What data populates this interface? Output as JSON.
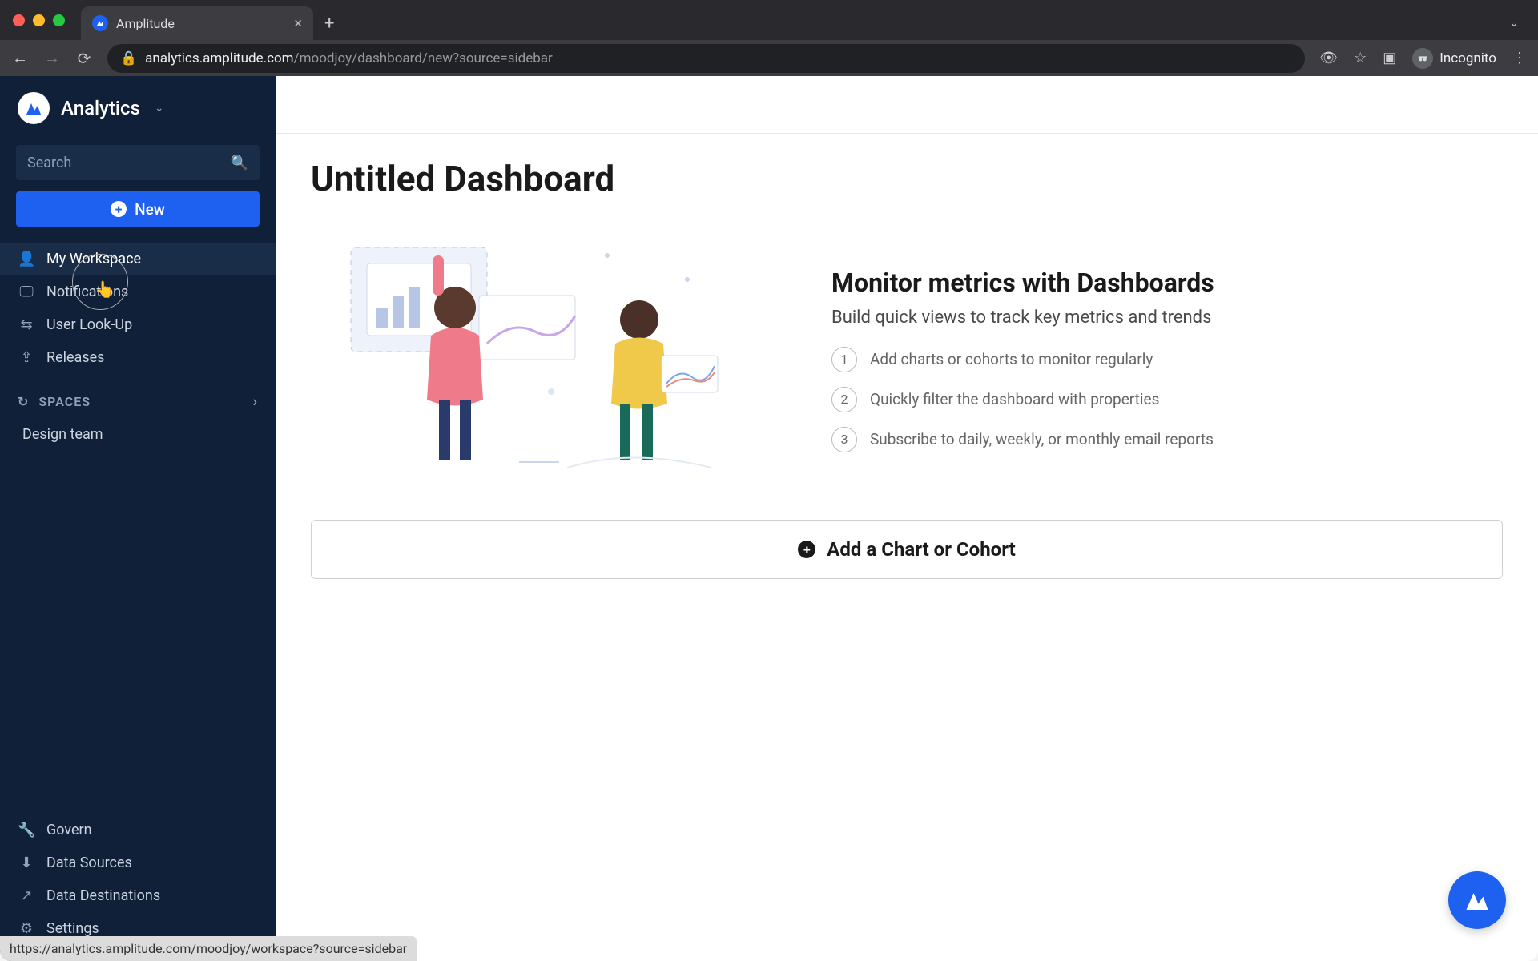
{
  "browser": {
    "tab_title": "Amplitude",
    "url_domain": "analytics.amplitude.com",
    "url_path": "/moodjoy/dashboard/new?source=sidebar",
    "incognito_label": "Incognito"
  },
  "sidebar": {
    "brand": "Analytics",
    "search_placeholder": "Search",
    "new_label": "New",
    "nav": [
      {
        "label": "My Workspace"
      },
      {
        "label": "Notifications"
      },
      {
        "label": "User Look-Up"
      },
      {
        "label": "Releases"
      }
    ],
    "spaces_header": "SPACES",
    "spaces": [
      {
        "label": "Design team"
      }
    ],
    "bottom": [
      {
        "label": "Govern"
      },
      {
        "label": "Data Sources"
      },
      {
        "label": "Data Destinations"
      },
      {
        "label": "Settings"
      }
    ]
  },
  "main": {
    "page_title": "Untitled Dashboard",
    "hero_title": "Monitor metrics with Dashboards",
    "hero_subtitle": "Build quick views to track key metrics and trends",
    "steps": [
      "Add charts or cohorts to monitor regularly",
      "Quickly filter the dashboard with properties",
      "Subscribe to daily, weekly, or monthly email reports"
    ],
    "add_button": "Add a Chart or Cohort"
  },
  "status_url": "https://analytics.amplitude.com/moodjoy/workspace?source=sidebar"
}
